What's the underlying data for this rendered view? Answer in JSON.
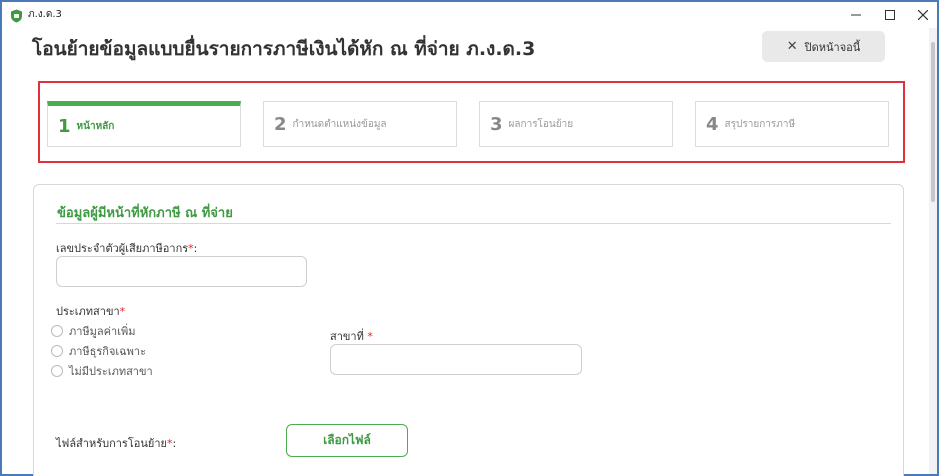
{
  "window": {
    "title": "ภ.ง.ด.3",
    "minimize_label": "—",
    "maximize_label": "☐",
    "close_label": "✕"
  },
  "header": {
    "title": "โอนย้ายข้อมูลแบบยื่นรายการภาษีเงินได้หัก ณ ที่จ่าย ภ.ง.ด.3",
    "close_button_icon": "✕",
    "close_button_label": "ปิดหน้าจอนี้"
  },
  "steps": [
    {
      "number": "1",
      "label": "หน้าหลัก",
      "active": true
    },
    {
      "number": "2",
      "label": "กำหนดตำแหน่งข้อมูล",
      "active": false
    },
    {
      "number": "3",
      "label": "ผลการโอนย้าย",
      "active": false
    },
    {
      "number": "4",
      "label": "สรุปรายการภาษี",
      "active": false
    }
  ],
  "form": {
    "section_title": "ข้อมูลผู้มีหน้าที่หักภาษี ณ ที่จ่าย",
    "tax_id_label": "เลขประจำตัวผู้เสียภาษีอากร",
    "tax_id_value": "",
    "branch_type_label": "ประเภทสาขา",
    "branch_type_options": [
      "ภาษีมูลค่าเพิ่ม",
      "ภาษีธุรกิจเฉพาะ",
      "ไม่มีประเภทสาขา"
    ],
    "branch_no_label": "สาขาที่",
    "branch_no_value": "",
    "file_label": "ไฟล์สำหรับการโอนย้าย",
    "choose_file_button": "เลือกไฟล์",
    "required_mark": "*",
    "colon": ":"
  },
  "colors": {
    "accent_green": "#3f9a43",
    "step_bar_green": "#4aad4e",
    "required_red": "#d9262e",
    "highlight_red": "#e0303a",
    "window_border": "#4a7ab8"
  }
}
